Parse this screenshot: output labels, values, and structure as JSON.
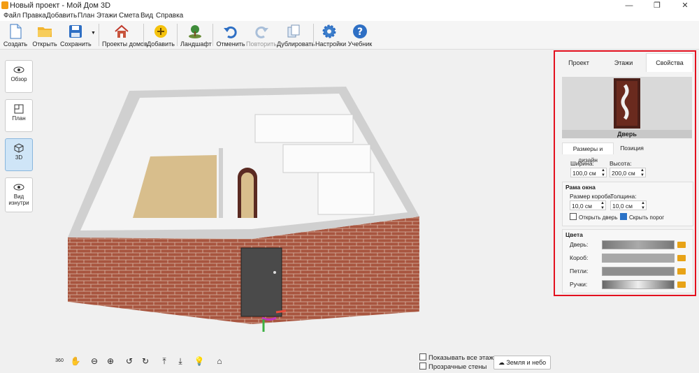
{
  "window": {
    "title": "Новый проект - Мой Дом 3D",
    "minimize": "—",
    "maximize": "❐",
    "close": "✕"
  },
  "menu": [
    "Файл",
    "Правка",
    "Добавить",
    "План",
    "Этажи",
    "Смета",
    "Вид",
    "Справка"
  ],
  "toolbar": {
    "create": "Создать",
    "open": "Открыть",
    "save": "Сохранить",
    "projects": "Проекты домов",
    "add": "Добавить",
    "landscape": "Ландшафт",
    "undo": "Отменить",
    "redo": "Повторить",
    "duplicate": "Дублировать",
    "settings": "Настройки",
    "tutorial": "Учебник"
  },
  "views": {
    "overview": "Обзор",
    "plan": "План",
    "v3d": "3D",
    "inside": "Вид изнутри"
  },
  "bottom": {
    "show_all_floors": "Показывать все этажи",
    "transparent_walls": "Прозрачные стены",
    "env_button": "Земля и небо",
    "rotate_label": "360"
  },
  "panel": {
    "tabs": [
      "Проект",
      "Этажи",
      "Свойства"
    ],
    "object_name": "Дверь",
    "subtabs": [
      "Размеры и дизайн",
      "Позиция"
    ],
    "width_label": "Ширина:",
    "width_value": "100,0 см",
    "height_label": "Высота:",
    "height_value": "200,0 см",
    "frame_title": "Рама окна",
    "frame_size_label": "Размер короба:",
    "frame_size_value": "10,0 см",
    "thickness_label": "Толщина:",
    "thickness_value": "10,0 см",
    "open_door": "Открыть дверь",
    "hide_threshold": "Скрыть порог",
    "colors_title": "Цвета",
    "color_rows": [
      "Дверь:",
      "Короб:",
      "Петли:",
      "Ручки:"
    ]
  },
  "colors": {
    "accent_red": "#e3101e",
    "brick": "#a8553f",
    "floor": "#d8be8c",
    "active_view": "#cfe5f7"
  }
}
